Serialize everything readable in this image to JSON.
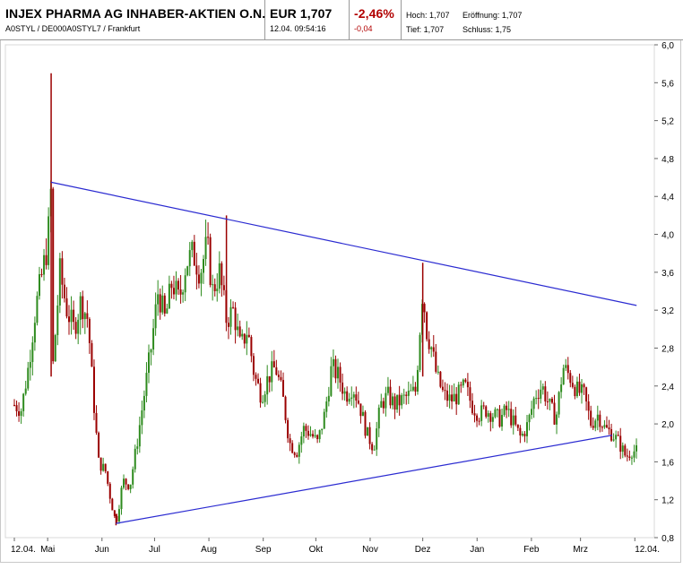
{
  "header": {
    "stock_name": "INJEX PHARMA AG INHABER-AKTIEN O.N.",
    "identifiers": "A0STYL / DE000A0STYL7 / Frankfurt",
    "price": "EUR 1,707",
    "datetime": "12.04. 09:54:16",
    "change_percent": "-2,46%",
    "change_absolute": "-0,04",
    "high": "Hoch: 1,707",
    "open": "Eröffnung: 1,707",
    "low": "Tief: 1,707",
    "close": "Schluss: 1,75"
  },
  "colors": {
    "up_candle": "#2e8b1e",
    "down_candle": "#9b0000",
    "trendline": "#2b2bd1",
    "change_negative": "#b20000"
  },
  "chart_data": {
    "type": "candlestick",
    "ylim": [
      0.8,
      6.0
    ],
    "y_ticks": [
      "6,0",
      "5,6",
      "5,2",
      "4,8",
      "4,4",
      "4,0",
      "3,6",
      "3,2",
      "2,8",
      "2,4",
      "2,0",
      "1,6",
      "1,2",
      "0,8"
    ],
    "y_tick_values": [
      6.0,
      5.6,
      5.2,
      4.8,
      4.4,
      4.0,
      3.6,
      3.2,
      2.8,
      2.4,
      2.0,
      1.6,
      1.2,
      0.8
    ],
    "x_labels": [
      "12.04.",
      "Mai",
      "Jun",
      "Jul",
      "Aug",
      "Sep",
      "Okt",
      "Nov",
      "Dez",
      "Jan",
      "Feb",
      "Mrz",
      "12.04."
    ],
    "x_label_days": [
      0,
      19,
      50,
      80,
      111,
      142,
      172,
      203,
      233,
      264,
      295,
      323,
      354
    ],
    "x_range_days": [
      0,
      360
    ],
    "price_points": [
      {
        "day": 0,
        "value": 2.2
      },
      {
        "day": 4,
        "value": 2.15
      },
      {
        "day": 8,
        "value": 2.6
      },
      {
        "day": 12,
        "value": 3.2
      },
      {
        "day": 16,
        "value": 3.6
      },
      {
        "day": 19,
        "value": 3.9
      },
      {
        "day": 21,
        "value": 4.5
      },
      {
        "day": 22,
        "value": 2.6
      },
      {
        "day": 26,
        "value": 3.6
      },
      {
        "day": 30,
        "value": 3.2
      },
      {
        "day": 34,
        "value": 3.0
      },
      {
        "day": 38,
        "value": 3.3
      },
      {
        "day": 42,
        "value": 3.1
      },
      {
        "day": 45,
        "value": 2.3
      },
      {
        "day": 48,
        "value": 1.6
      },
      {
        "day": 52,
        "value": 1.5
      },
      {
        "day": 55,
        "value": 1.2
      },
      {
        "day": 58,
        "value": 0.95
      },
      {
        "day": 62,
        "value": 1.4
      },
      {
        "day": 66,
        "value": 1.35
      },
      {
        "day": 70,
        "value": 1.8
      },
      {
        "day": 74,
        "value": 2.3
      },
      {
        "day": 78,
        "value": 2.8
      },
      {
        "day": 82,
        "value": 3.4
      },
      {
        "day": 86,
        "value": 3.1
      },
      {
        "day": 90,
        "value": 3.5
      },
      {
        "day": 94,
        "value": 3.3
      },
      {
        "day": 98,
        "value": 3.7
      },
      {
        "day": 102,
        "value": 3.8
      },
      {
        "day": 106,
        "value": 3.6
      },
      {
        "day": 110,
        "value": 3.9
      },
      {
        "day": 113,
        "value": 3.4
      },
      {
        "day": 117,
        "value": 3.6
      },
      {
        "day": 121,
        "value": 3.1
      },
      {
        "day": 125,
        "value": 3.2
      },
      {
        "day": 129,
        "value": 2.8
      },
      {
        "day": 133,
        "value": 3.0
      },
      {
        "day": 137,
        "value": 2.5
      },
      {
        "day": 141,
        "value": 2.3
      },
      {
        "day": 145,
        "value": 2.5
      },
      {
        "day": 149,
        "value": 2.6
      },
      {
        "day": 153,
        "value": 2.3
      },
      {
        "day": 157,
        "value": 1.8
      },
      {
        "day": 161,
        "value": 1.7
      },
      {
        "day": 165,
        "value": 1.95
      },
      {
        "day": 169,
        "value": 1.9
      },
      {
        "day": 173,
        "value": 1.8
      },
      {
        "day": 177,
        "value": 2.1
      },
      {
        "day": 181,
        "value": 2.6
      },
      {
        "day": 185,
        "value": 2.5
      },
      {
        "day": 189,
        "value": 2.3
      },
      {
        "day": 193,
        "value": 2.4
      },
      {
        "day": 197,
        "value": 2.2
      },
      {
        "day": 201,
        "value": 1.9
      },
      {
        "day": 205,
        "value": 1.75
      },
      {
        "day": 209,
        "value": 2.2
      },
      {
        "day": 213,
        "value": 2.3
      },
      {
        "day": 217,
        "value": 2.2
      },
      {
        "day": 221,
        "value": 2.25
      },
      {
        "day": 225,
        "value": 2.3
      },
      {
        "day": 229,
        "value": 2.35
      },
      {
        "day": 233,
        "value": 3.45
      },
      {
        "day": 235,
        "value": 3.0
      },
      {
        "day": 238,
        "value": 2.8
      },
      {
        "day": 241,
        "value": 2.5
      },
      {
        "day": 245,
        "value": 2.3
      },
      {
        "day": 249,
        "value": 2.25
      },
      {
        "day": 253,
        "value": 2.3
      },
      {
        "day": 257,
        "value": 2.4
      },
      {
        "day": 261,
        "value": 2.2
      },
      {
        "day": 265,
        "value": 2.1
      },
      {
        "day": 269,
        "value": 2.15
      },
      {
        "day": 273,
        "value": 2.1
      },
      {
        "day": 277,
        "value": 2.05
      },
      {
        "day": 281,
        "value": 2.15
      },
      {
        "day": 285,
        "value": 2.0
      },
      {
        "day": 289,
        "value": 1.85
      },
      {
        "day": 293,
        "value": 2.0
      },
      {
        "day": 297,
        "value": 2.3
      },
      {
        "day": 301,
        "value": 2.4
      },
      {
        "day": 305,
        "value": 2.2
      },
      {
        "day": 309,
        "value": 2.05
      },
      {
        "day": 313,
        "value": 2.6
      },
      {
        "day": 317,
        "value": 2.5
      },
      {
        "day": 321,
        "value": 2.35
      },
      {
        "day": 325,
        "value": 2.3
      },
      {
        "day": 329,
        "value": 2.0
      },
      {
        "day": 333,
        "value": 2.1
      },
      {
        "day": 337,
        "value": 1.95
      },
      {
        "day": 341,
        "value": 1.9
      },
      {
        "day": 345,
        "value": 1.8
      },
      {
        "day": 349,
        "value": 1.65
      },
      {
        "day": 352,
        "value": 1.72
      },
      {
        "day": 355,
        "value": 1.707
      }
    ],
    "spikes": [
      {
        "day": 21,
        "high": 5.7,
        "low": 2.5
      },
      {
        "day": 121,
        "high": 4.2,
        "low": 3.1
      },
      {
        "day": 233,
        "high": 3.7,
        "low": 2.5
      },
      {
        "day": 58,
        "high": 1.05,
        "low": 0.93
      }
    ],
    "trendlines": [
      {
        "from": {
          "day": 21,
          "value": 4.55
        },
        "to": {
          "day": 355,
          "value": 3.25
        }
      },
      {
        "from": {
          "day": 58,
          "value": 0.95
        },
        "to": {
          "day": 341,
          "value": 1.88
        }
      }
    ]
  }
}
